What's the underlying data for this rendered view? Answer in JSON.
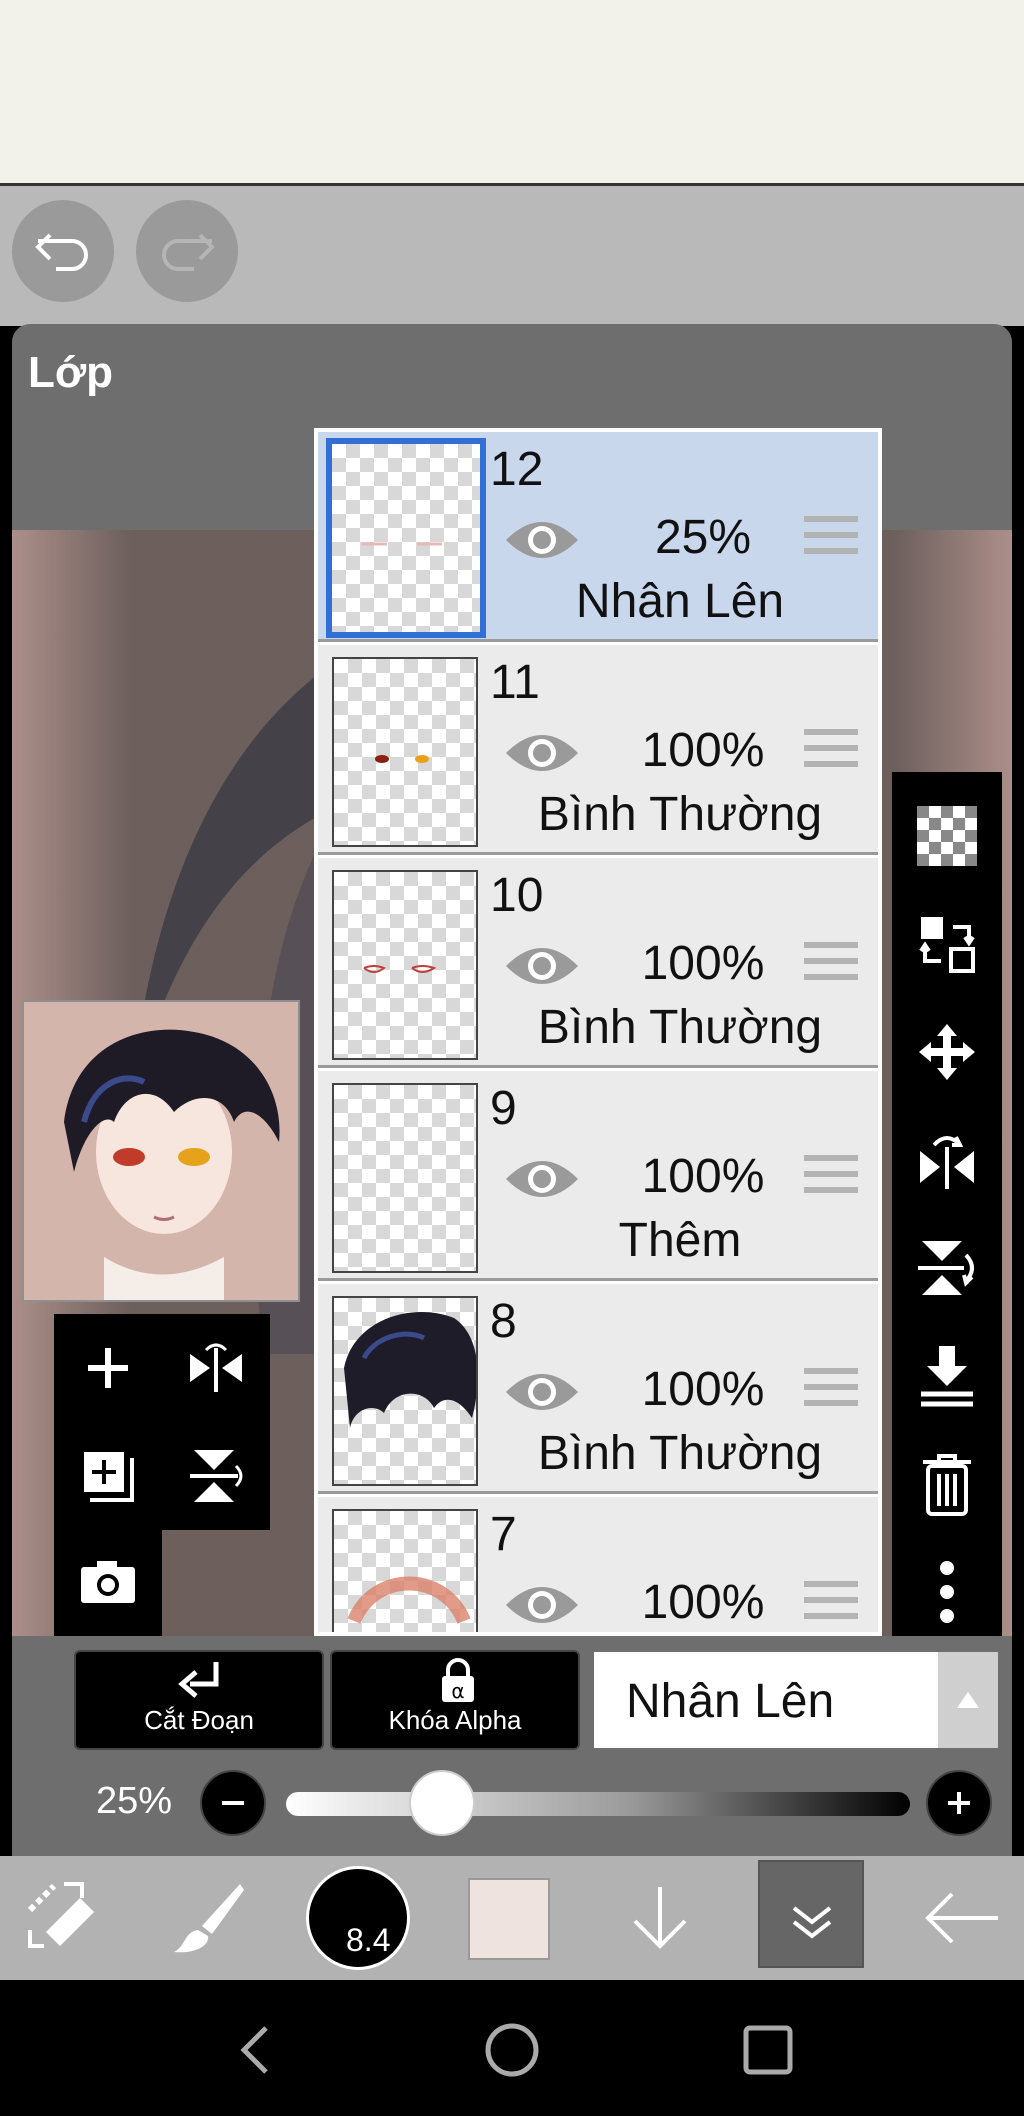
{
  "panel": {
    "title": "Lớp"
  },
  "layers": [
    {
      "number": "12",
      "opacity": "25%",
      "blend": "Nhân Lên",
      "selected": true
    },
    {
      "number": "11",
      "opacity": "100%",
      "blend": "Bình Thường",
      "selected": false
    },
    {
      "number": "10",
      "opacity": "100%",
      "blend": "Bình Thường",
      "selected": false
    },
    {
      "number": "9",
      "opacity": "100%",
      "blend": "Thêm",
      "selected": false
    },
    {
      "number": "8",
      "opacity": "100%",
      "blend": "Bình Thường",
      "selected": false
    },
    {
      "number": "7",
      "opacity": "100%",
      "blend": "",
      "selected": false
    }
  ],
  "actions": {
    "clipping_label": "Cắt Đoạn",
    "alpha_lock_label": "Khóa Alpha"
  },
  "blend_mode": {
    "selected": "Nhân Lên"
  },
  "opacity_slider": {
    "label": "25%",
    "value": 0.25
  },
  "toolbar": {
    "brush_size": "8.4",
    "color": "#eee3de"
  },
  "icons": {
    "undo": "undo-icon",
    "redo": "redo-icon",
    "add_layer": "plus-icon",
    "flip_h": "flip-horizontal-icon",
    "copy_layer": "add-copy-icon",
    "flip_v": "flip-vertical-icon",
    "camera": "camera-icon",
    "transparency": "checkerboard-icon",
    "swap": "swap-icon",
    "move": "move-icon",
    "merge_down": "merge-down-icon",
    "delete": "trash-icon",
    "more": "more-vertical-icon"
  }
}
